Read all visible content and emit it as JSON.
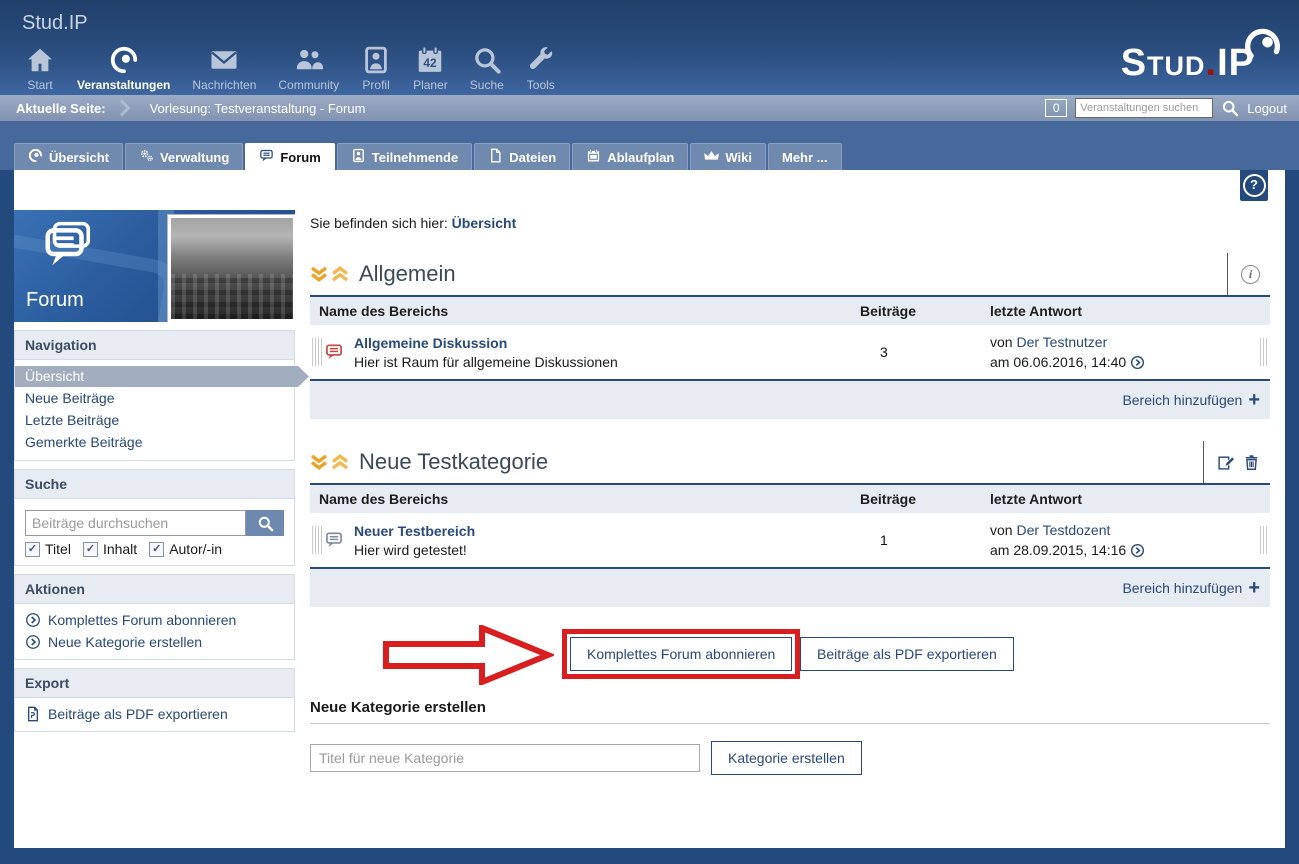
{
  "header": {
    "site_title": "Stud.IP",
    "nav": [
      {
        "label": "Start"
      },
      {
        "label": "Veranstaltungen"
      },
      {
        "label": "Nachrichten"
      },
      {
        "label": "Community"
      },
      {
        "label": "Profil"
      },
      {
        "label": "Planer",
        "badge": "42"
      },
      {
        "label": "Suche"
      },
      {
        "label": "Tools"
      }
    ],
    "logo": {
      "part1": "Stud",
      "dot": ".",
      "part2": "IP"
    }
  },
  "breadcrumb": {
    "label": "Aktuelle Seite:",
    "page": "Vorlesung: Testveranstaltung - Forum",
    "counter": "0",
    "search_placeholder": "Veranstaltungen suchen",
    "logout": "Logout"
  },
  "tabs": [
    {
      "label": "Übersicht"
    },
    {
      "label": "Verwaltung"
    },
    {
      "label": "Forum"
    },
    {
      "label": "Teilnehmende"
    },
    {
      "label": "Dateien"
    },
    {
      "label": "Ablaufplan"
    },
    {
      "label": "Wiki"
    },
    {
      "label": "Mehr ..."
    }
  ],
  "sidebar": {
    "banner_title": "Forum",
    "navigation": {
      "title": "Navigation",
      "items": [
        {
          "label": "Übersicht"
        },
        {
          "label": "Neue Beiträge"
        },
        {
          "label": "Letzte Beiträge"
        },
        {
          "label": "Gemerkte Beiträge"
        }
      ]
    },
    "search": {
      "title": "Suche",
      "placeholder": "Beiträge durchsuchen",
      "checkboxes": [
        {
          "label": "Titel"
        },
        {
          "label": "Inhalt"
        },
        {
          "label": "Autor/-in"
        }
      ]
    },
    "actions": {
      "title": "Aktionen",
      "items": [
        {
          "label": "Komplettes Forum abonnieren"
        },
        {
          "label": "Neue Kategorie erstellen"
        }
      ]
    },
    "export": {
      "title": "Export",
      "items": [
        {
          "label": "Beiträge als PDF exportieren"
        }
      ]
    }
  },
  "main": {
    "location_label": "Sie befinden sich hier:",
    "location_link": "Übersicht",
    "columns": {
      "name": "Name des Bereichs",
      "posts": "Beiträge",
      "last": "letzte Antwort"
    },
    "categories": [
      {
        "title": "Allgemein",
        "row": {
          "name": "Allgemeine Diskussion",
          "description": "Hier ist Raum für allgemeine Diskussionen",
          "posts": "3",
          "by": "von",
          "author": "Der Testnutzer",
          "date": "am 06.06.2016, 14:40"
        },
        "footer_link": "Bereich hinzufügen"
      },
      {
        "title": "Neue Testkategorie",
        "row": {
          "name": "Neuer Testbereich",
          "description": "Hier wird getestet!",
          "posts": "1",
          "by": "von",
          "author": "Der Testdozent",
          "date": "am 28.09.2015, 14:16"
        },
        "footer_link": "Bereich hinzufügen"
      }
    ],
    "subscribe_button": "Komplettes Forum abonnieren",
    "export_button": "Beiträge als PDF exportieren",
    "new_category": {
      "heading": "Neue Kategorie erstellen",
      "placeholder": "Titel für neue Kategorie",
      "button": "Kategorie erstellen"
    }
  },
  "colors": {
    "base_navy": "#28497c",
    "annotation_red": "#d81e1e",
    "chevron_orange": "#eda32a",
    "unread_icon_red": "#c2453f"
  }
}
